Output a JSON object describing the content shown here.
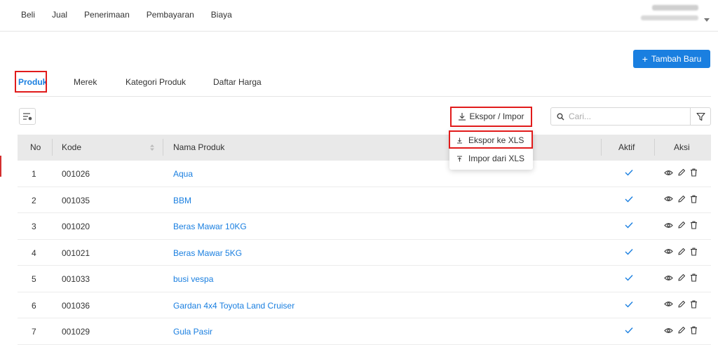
{
  "topnav": [
    "Beli",
    "Jual",
    "Penerimaan",
    "Pembayaran",
    "Biaya"
  ],
  "add_button": {
    "label": "Tambah Baru",
    "icon": "plus-icon"
  },
  "tabs": [
    "Produk",
    "Merek",
    "Kategori Produk",
    "Daftar Harga"
  ],
  "toolbar": {
    "export_label": "Ekspor / Impor",
    "search_placeholder": "Cari..."
  },
  "dropdown": {
    "items": [
      "Ekspor ke XLS",
      "Impor dari XLS"
    ]
  },
  "table": {
    "headers": {
      "no": "No",
      "kode": "Kode",
      "nama": "Nama Produk",
      "aktif": "Aktif",
      "aksi": "Aksi"
    },
    "rows": [
      {
        "no": "1",
        "kode": "001026",
        "nama": "Aqua"
      },
      {
        "no": "2",
        "kode": "001035",
        "nama": "BBM"
      },
      {
        "no": "3",
        "kode": "001020",
        "nama": "Beras Mawar 10KG"
      },
      {
        "no": "4",
        "kode": "001021",
        "nama": "Beras Mawar 5KG"
      },
      {
        "no": "5",
        "kode": "001033",
        "nama": "busi vespa"
      },
      {
        "no": "6",
        "kode": "001036",
        "nama": "Gardan 4x4 Toyota Land Cruiser"
      },
      {
        "no": "7",
        "kode": "001029",
        "nama": "Gula Pasir"
      }
    ]
  },
  "colors": {
    "accent": "#1a7fe0",
    "highlight": "#e11b1b",
    "header_bg": "#e9e9e9"
  }
}
